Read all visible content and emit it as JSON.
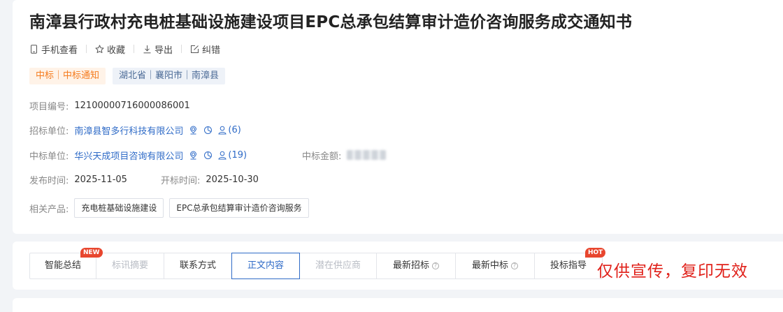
{
  "page": {
    "title": "南漳县行政村充电桩基础设施建设项目EPC总承包结算审计造价咨询服务成交通知书"
  },
  "actions": {
    "mobile": {
      "label": "手机查看",
      "icon": "mobile-phone-icon"
    },
    "favorite": {
      "label": "收藏",
      "icon": "star-icon"
    },
    "export": {
      "label": "导出",
      "icon": "download-icon"
    },
    "correct": {
      "label": "纠错",
      "icon": "edit-icon"
    }
  },
  "tags": {
    "type": "中标｜中标通知",
    "region": "湖北省｜襄阳市｜南漳县"
  },
  "details": {
    "project_no_label": "项目编号:",
    "project_no": "12100000716000086001",
    "buyer_label": "招标单位:",
    "buyer": "南漳县智多行科技有限公司",
    "buyer_contacts": "(6)",
    "winner_label": "中标单位:",
    "winner": "华兴天成项目咨询有限公司",
    "winner_contacts": "(19)",
    "amount_label": "中标金额:",
    "publish_label": "发布时间:",
    "publish_date": "2025-11-05",
    "open_label": "开标时间:",
    "open_date": "2025-10-30",
    "products_label": "相关产品:",
    "products": [
      "充电桩基础设施建设",
      "EPC总承包结算审计造价咨询服务"
    ]
  },
  "tabs": [
    {
      "label": "智能总结",
      "badge": "NEW"
    },
    {
      "label": "标讯摘要"
    },
    {
      "label": "联系方式"
    },
    {
      "label": "正文内容"
    },
    {
      "label": "潜在供应商"
    },
    {
      "label": "最新招标"
    },
    {
      "label": "最新中标"
    },
    {
      "label": "投标指导",
      "badge": "HOT"
    }
  ],
  "tab_help_mark": "?",
  "watermark": "仅供宣传，复印无效",
  "colors": {
    "link": "#2f6bc7",
    "tag_orange": "#f57c1f",
    "tag_blue": "#4b6a96",
    "badge_red": "#e8462e",
    "watermark_red": "#e0211a"
  }
}
